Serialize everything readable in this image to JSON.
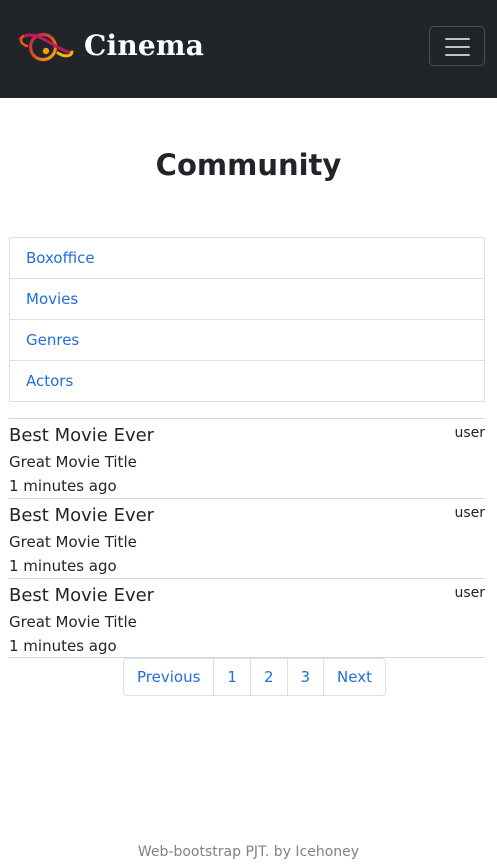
{
  "navbar": {
    "brand_text": "Cinema",
    "logo_icon": "planet-icon",
    "menu_icon": "hamburger-icon",
    "colors": {
      "background": "#212529",
      "logo_orange": "#f39c12",
      "logo_purple": "#c2185b"
    }
  },
  "page": {
    "title": "Community"
  },
  "categories": [
    {
      "label": "Boxoffice"
    },
    {
      "label": "Movies"
    },
    {
      "label": "Genres"
    },
    {
      "label": "Actors"
    }
  ],
  "posts": [
    {
      "title": "Best Movie Ever",
      "movie": "Great Movie Title",
      "time": "1 minutes ago",
      "user": "user"
    },
    {
      "title": "Best Movie Ever",
      "movie": "Great Movie Title",
      "time": "1 minutes ago",
      "user": "user"
    },
    {
      "title": "Best Movie Ever",
      "movie": "Great Movie Title",
      "time": "1 minutes ago",
      "user": "user"
    }
  ],
  "pagination": {
    "previous": "Previous",
    "pages": [
      "1",
      "2",
      "3"
    ],
    "next": "Next"
  },
  "footer": {
    "text": "Web-bootstrap PJT. by Icehoney"
  },
  "colors": {
    "link": "#1f6fd6",
    "border": "#dcdfe2",
    "text": "#212529",
    "muted": "#7d838a"
  }
}
